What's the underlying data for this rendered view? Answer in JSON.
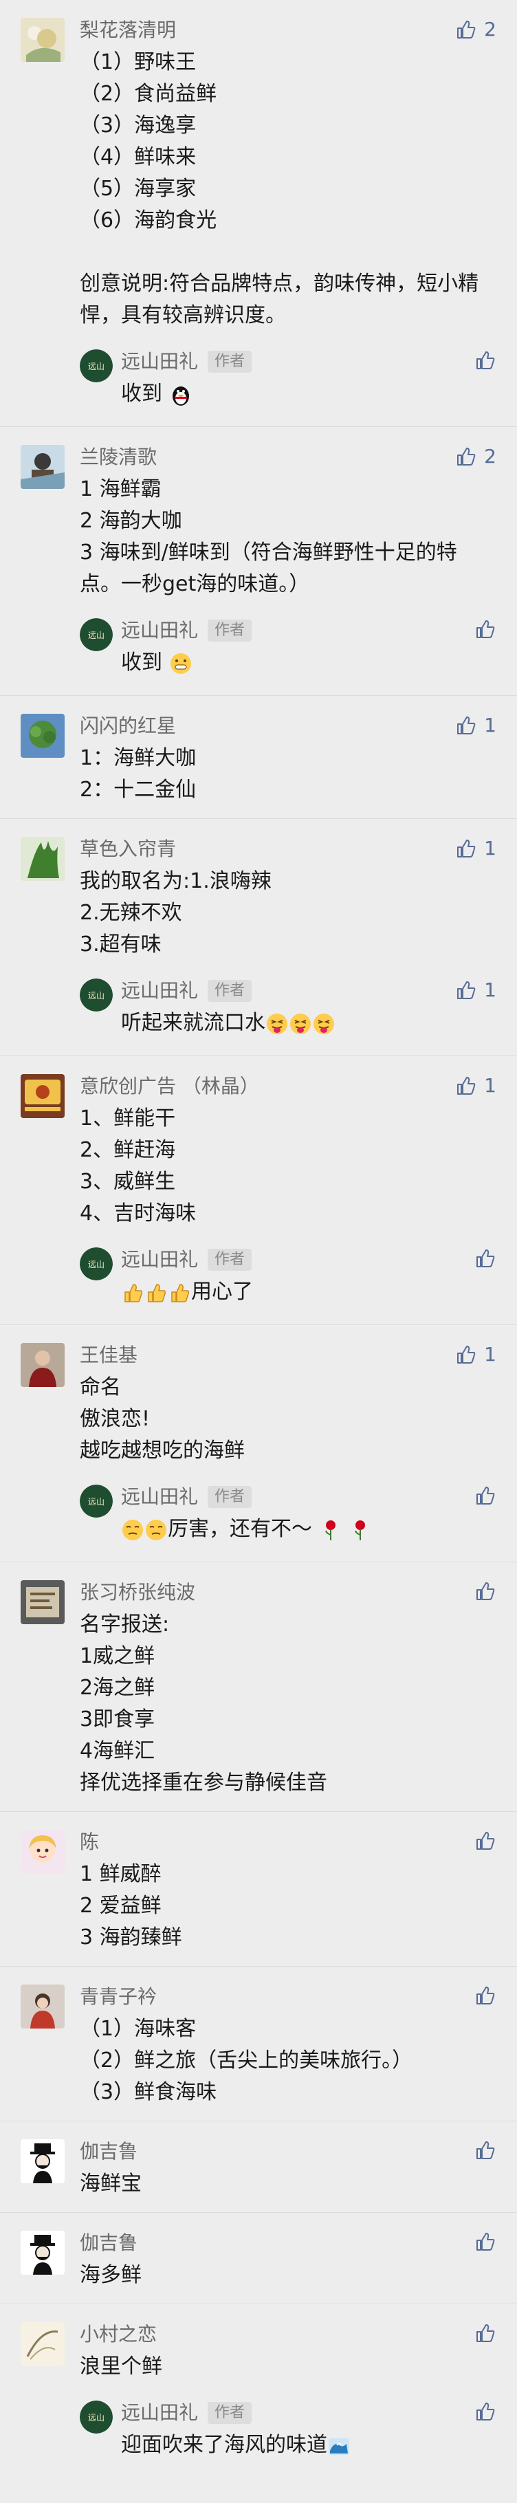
{
  "comments": [
    {
      "user": "梨花落清明",
      "likes": "2",
      "content": "（1）野味王\n（2）食尚益鲜\n（3）海逸享\n（4）鲜味来\n（5）海享家\n（6）海韵食光\n\n创意说明:符合品牌特点，韵味传神，短小精悍，具有较高辨识度。",
      "reply": {
        "user": "远山田礼",
        "badge": "作者",
        "likes": "",
        "content": "收到"
      }
    },
    {
      "user": "兰陵清歌",
      "likes": "2",
      "content": "1 海鲜霸\n2 海韵大咖\n3 海味到/鲜味到（符合海鲜野性十足的特点。一秒get海的味道。）",
      "reply": {
        "user": "远山田礼",
        "badge": "作者",
        "likes": "",
        "content": "收到"
      }
    },
    {
      "user": "闪闪的红星",
      "likes": "1",
      "content": "1：海鲜大咖\n2：十二金仙"
    },
    {
      "user": "草色入帘青",
      "likes": "1",
      "content": "我的取名为:1.浪嗨辣\n2.无辣不欢\n3.超有味",
      "reply": {
        "user": "远山田礼",
        "badge": "作者",
        "likes": "1",
        "content": "听起来就流口水"
      }
    },
    {
      "user": "意欣创广告 （林晶）",
      "likes": "1",
      "content": "1、鲜能干\n2、鲜赶海\n3、威鲜生\n4、吉时海味",
      "reply": {
        "user": "远山田礼",
        "badge": "作者",
        "likes": "",
        "content": "用心了"
      }
    },
    {
      "user": "王佳基",
      "likes": "1",
      "content": "命名\n傲浪恋!\n越吃越想吃的海鲜",
      "reply": {
        "user": "远山田礼",
        "badge": "作者",
        "likes": "",
        "content": "厉害，还有不～"
      }
    },
    {
      "user": "张习桥张纯波",
      "likes": "",
      "content": "名字报送:\n1威之鲜\n2海之鲜\n3即食享\n4海鲜汇\n择优选择重在参与静候佳音"
    },
    {
      "user": "陈",
      "likes": "",
      "content": "1 鲜威醉\n2 爱益鲜\n3 海韵臻鲜"
    },
    {
      "user": "青青子衿",
      "likes": "",
      "content": "（1）海味客\n（2）鲜之旅（舌尖上的美味旅行。）\n（3）鲜食海味"
    },
    {
      "user": "伽吉鲁",
      "likes": "",
      "content": "海鲜宝"
    },
    {
      "user": "伽吉鲁",
      "likes": "",
      "content": "海多鲜"
    },
    {
      "user": "小村之恋",
      "likes": "",
      "content": "浪里个鲜",
      "reply": {
        "user": "远山田礼",
        "badge": "作者",
        "likes": "",
        "content": "迎面吹来了海风的味道"
      }
    }
  ],
  "colors": {
    "background": "#ededed",
    "link_blue": "#576b95",
    "name_gray": "#6b6b6b",
    "author_green": "#1f4d2f"
  },
  "icons": {
    "like": "thumb-up-outline-icon"
  }
}
